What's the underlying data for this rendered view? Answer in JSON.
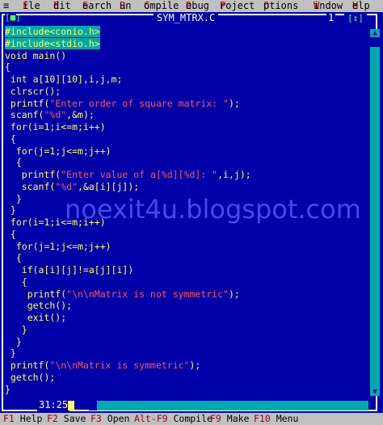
{
  "menubar": {
    "system_glyph": "≡",
    "items": [
      {
        "hot": "F",
        "rest": "ile"
      },
      {
        "hot": "E",
        "rest": "dit"
      },
      {
        "hot": "S",
        "rest": "earch"
      },
      {
        "hot": "R",
        "rest": "un"
      },
      {
        "hot": "C",
        "rest": "ompile"
      },
      {
        "hot": "D",
        "rest": "ebug"
      },
      {
        "hot": "P",
        "rest": "roject"
      },
      {
        "hot": "O",
        "rest": "ptions"
      },
      {
        "hot": "W",
        "rest": "indow"
      },
      {
        "hot": "H",
        "rest": "elp"
      }
    ]
  },
  "window": {
    "close_glyph": "[■]",
    "title": "SYM_MTRX.C",
    "number": "1",
    "zoom_glyph": "[↕]",
    "cursor_position": "31:25"
  },
  "code_lines": [
    {
      "parts": [
        {
          "t": "#include<conio.h>",
          "c": "i"
        }
      ],
      "highlight": true
    },
    {
      "parts": [
        {
          "t": "#include<stdio.h>",
          "c": "i"
        }
      ],
      "highlight": true
    },
    {
      "parts": [
        {
          "t": "void main()",
          "c": "t"
        }
      ]
    },
    {
      "parts": [
        {
          "t": "{",
          "c": "t"
        }
      ]
    },
    {
      "parts": [
        {
          "t": " int a[10][10],i,j,m;",
          "c": "t"
        }
      ]
    },
    {
      "parts": [
        {
          "t": " clrscr();",
          "c": "t"
        }
      ]
    },
    {
      "parts": [
        {
          "t": " printf(",
          "c": "t"
        },
        {
          "t": "\"Enter order of square matrix: \"",
          "c": "s"
        },
        {
          "t": ");",
          "c": "t"
        }
      ]
    },
    {
      "parts": [
        {
          "t": " scanf(",
          "c": "t"
        },
        {
          "t": "\"%d\"",
          "c": "s"
        },
        {
          "t": ",&m);",
          "c": "t"
        }
      ]
    },
    {
      "parts": [
        {
          "t": " for(i=1;i<=m;i++)",
          "c": "t"
        }
      ]
    },
    {
      "parts": [
        {
          "t": " {",
          "c": "t"
        }
      ]
    },
    {
      "parts": [
        {
          "t": "  for(j=1;j<=m;j++)",
          "c": "t"
        }
      ]
    },
    {
      "parts": [
        {
          "t": "  {",
          "c": "t"
        }
      ]
    },
    {
      "parts": [
        {
          "t": "   printf(",
          "c": "t"
        },
        {
          "t": "\"Enter value of a[%d][%d]: \"",
          "c": "s"
        },
        {
          "t": ",i,j);",
          "c": "t"
        }
      ]
    },
    {
      "parts": [
        {
          "t": "   scanf(",
          "c": "t"
        },
        {
          "t": "\"%d\"",
          "c": "s"
        },
        {
          "t": ",&a[i][j]);",
          "c": "t"
        }
      ]
    },
    {
      "parts": [
        {
          "t": "  }",
          "c": "t"
        }
      ]
    },
    {
      "parts": [
        {
          "t": " }",
          "c": "t"
        }
      ]
    },
    {
      "parts": [
        {
          "t": " for(i=1;i<=m;i++)",
          "c": "t"
        }
      ]
    },
    {
      "parts": [
        {
          "t": " {",
          "c": "t"
        }
      ]
    },
    {
      "parts": [
        {
          "t": "  for(j=1;j<=m;j++)",
          "c": "t"
        }
      ]
    },
    {
      "parts": [
        {
          "t": "  {",
          "c": "t"
        }
      ]
    },
    {
      "parts": [
        {
          "t": "   if(a[i][j]!=a[j][i])",
          "c": "t"
        }
      ]
    },
    {
      "parts": [
        {
          "t": "   {",
          "c": "t"
        }
      ]
    },
    {
      "parts": [
        {
          "t": "    printf(",
          "c": "t"
        },
        {
          "t": "\"\\n\\nMatrix is not symmetric\"",
          "c": "s"
        },
        {
          "t": ");",
          "c": "t"
        }
      ]
    },
    {
      "parts": [
        {
          "t": "    getch();",
          "c": "t"
        }
      ]
    },
    {
      "parts": [
        {
          "t": "    exit();",
          "c": "t"
        }
      ]
    },
    {
      "parts": [
        {
          "t": "   }",
          "c": "t"
        }
      ]
    },
    {
      "parts": [
        {
          "t": "  }",
          "c": "t"
        }
      ]
    },
    {
      "parts": [
        {
          "t": " }",
          "c": "t"
        }
      ]
    },
    {
      "parts": [
        {
          "t": " printf(",
          "c": "t"
        },
        {
          "t": "\"\\n\\nMatrix is symmetric\"",
          "c": "s"
        },
        {
          "t": ");",
          "c": "t"
        }
      ]
    },
    {
      "parts": [
        {
          "t": " getch();",
          "c": "t"
        }
      ]
    },
    {
      "parts": [
        {
          "t": "}",
          "c": "t"
        }
      ]
    }
  ],
  "watermark": "noexit4u.blogspot.com",
  "statusbar": [
    {
      "key": "F1",
      "label": " Help"
    },
    {
      "key": "F2",
      "label": " Save"
    },
    {
      "key": "F3",
      "label": " Open"
    },
    {
      "key": "Alt-F9",
      "label": " Compile"
    },
    {
      "key": "F9",
      "label": " Make"
    },
    {
      "key": "F10",
      "label": " Menu"
    }
  ],
  "colors": {
    "background": "#0000a8",
    "menubar": "#c0c0c0",
    "hotkey": "#a80000",
    "code_text": "#ffff55",
    "string_literal": "#ff5555",
    "include_highlight": "#00aaaa"
  }
}
